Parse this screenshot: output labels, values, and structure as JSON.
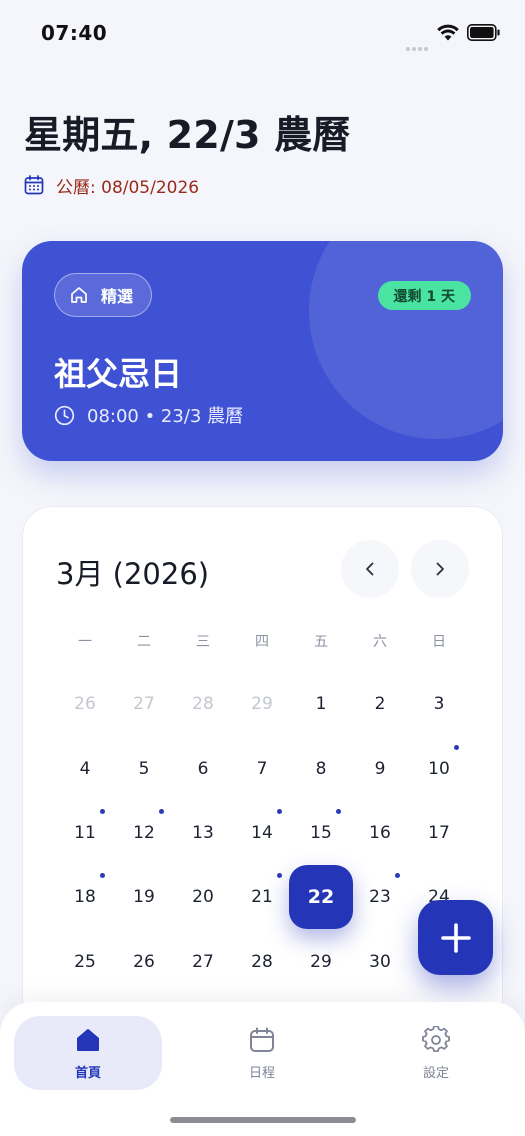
{
  "status_bar": {
    "time": "07:40"
  },
  "header": {
    "title": "星期五, 22/3 農曆",
    "solar_date": "公曆: 08/05/2026"
  },
  "featured": {
    "tag": "精選",
    "countdown": "還剩 1 天",
    "title": "祖父忌日",
    "meta": "08:00 • 23/3 農曆",
    "color": "#3f52d4",
    "badge_color": "#4be3a1"
  },
  "calendar": {
    "month_label": "3月 (2026)",
    "weekdays": [
      "一",
      "二",
      "三",
      "四",
      "五",
      "六",
      "日"
    ],
    "weeks": [
      [
        "26",
        "27",
        "28",
        "29",
        "1",
        "2",
        "3"
      ],
      [
        "4",
        "5",
        "6",
        "7",
        "8",
        "9",
        "10"
      ],
      [
        "11",
        "12",
        "13",
        "14",
        "15",
        "16",
        "17"
      ],
      [
        "18",
        "19",
        "20",
        "21",
        "22",
        "23",
        "24"
      ],
      [
        "25",
        "26",
        "27",
        "28",
        "29",
        "30",
        ""
      ]
    ],
    "selected_day": "22",
    "accent_color": "#2435b8"
  },
  "bottom_nav": {
    "items": [
      {
        "label": "首頁",
        "icon": "home-icon",
        "active": true
      },
      {
        "label": "日程",
        "icon": "calendar-icon",
        "active": false
      },
      {
        "label": "設定",
        "icon": "gear-icon",
        "active": false
      }
    ]
  }
}
